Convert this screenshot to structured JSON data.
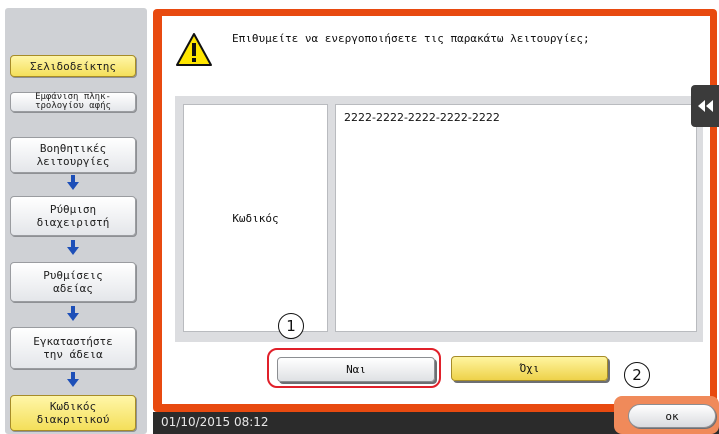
{
  "sidebar": {
    "bookmark": "Σελιδοδείκτης",
    "keypad": "Εμφάνιση πληκ-\nτρολογίου αφής",
    "steps": [
      {
        "label": "Βοηθητικές\nλειτουργίες"
      },
      {
        "label": "Ρύθμιση\nδιαχειριστή"
      },
      {
        "label": "Ρυθμίσεις\nαδείας"
      },
      {
        "label": "Εγκαταστήστε\nτην άδεια"
      },
      {
        "label": "Κωδικός\nδιακριτικού"
      }
    ]
  },
  "dialog": {
    "prompt": "Επιθυμείτε να ενεργοποιήσετε τις παρακάτω λειτουργίες;",
    "field_label": "Κωδικός",
    "field_value": "2222-2222-2222-2222-2222",
    "yes": "Ναι",
    "no": "Όχι"
  },
  "callouts": {
    "one": "1",
    "two": "2"
  },
  "status": {
    "datetime": "01/10/2015  08:12",
    "ok": "οκ"
  },
  "colors": {
    "frame": "#e84a10",
    "highlight": "#e0202a",
    "yellow_button": "#f4df5a"
  },
  "icons": [
    "warning-icon",
    "down-arrow-icon",
    "collapse-panel-icon"
  ]
}
